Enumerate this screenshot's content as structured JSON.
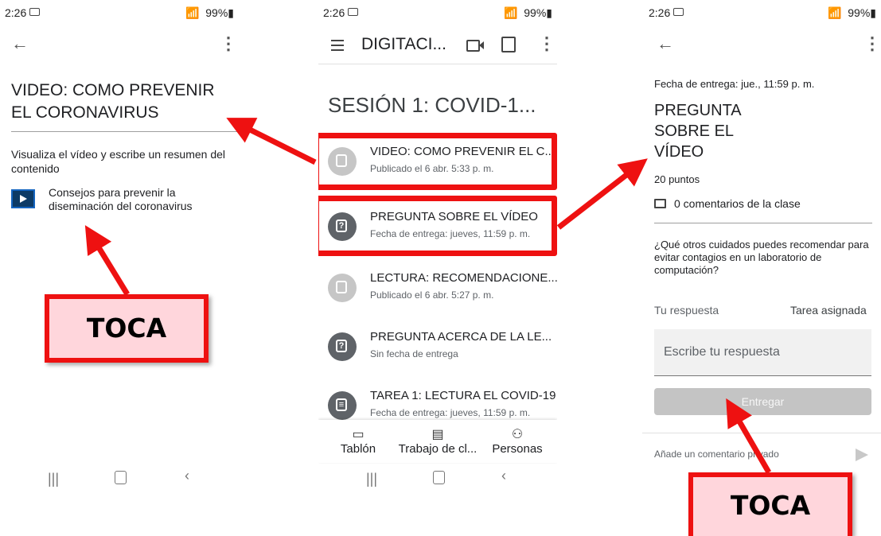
{
  "status": {
    "time": "2:26",
    "icons": "  99%"
  },
  "left": {
    "title_line1": "VIDEO: COMO PREVENIR",
    "title_line2": "EL CORONAVIRUS",
    "desc": "Visualiza el vídeo y escribe un resumen del contenido",
    "attachment_line1": "Consejos para prevenir la",
    "attachment_line2": "diseminación del coronavirus",
    "callout": "TOCA"
  },
  "middle": {
    "class_name": "DIGITACI...",
    "section": "SESIÓN 1: COVID-1...",
    "items": [
      {
        "title": "VIDEO: COMO PREVENIR EL C...",
        "sub": "Publicado el 6 abr. 5:33 p. m.",
        "icon": "book-icon"
      },
      {
        "title": "PREGUNTA SOBRE EL VÍDEO",
        "sub": "Fecha de entrega: jueves, 11:59 p. m.",
        "icon": "question-icon"
      },
      {
        "title": "LECTURA: RECOMENDACIONE...",
        "sub": "Publicado el 6 abr. 5:27 p. m.",
        "icon": "book-icon"
      },
      {
        "title": "PREGUNTA ACERCA DE LA LE...",
        "sub": "Sin fecha de entrega",
        "icon": "question-icon"
      },
      {
        "title": "TAREA 1: LECTURA EL COVID-19",
        "sub": "Fecha de entrega: jueves, 11:59 p. m.",
        "icon": "assignment-icon"
      }
    ],
    "tabs": [
      "Tablón",
      "Trabajo de cl...",
      "Personas"
    ]
  },
  "right": {
    "due": "Fecha de entrega: jue., 11:59 p. m.",
    "title_line1": "PREGUNTA",
    "title_line2": "SOBRE EL",
    "title_line3": "VÍDEO",
    "points": "20 puntos",
    "comments": "0 comentarios de la clase",
    "question": "¿Qué otros cuidados puedes recomendar para evitar contagios en un laboratorio de computación?",
    "your_answer": "Tu respuesta",
    "status": "Tarea asignada",
    "answer_placeholder": "Escribe tu respuesta",
    "submit": "Entregar",
    "private_comment": "Añade un comentario privado",
    "callout": "TOCA"
  },
  "colors": {
    "red": "#ee1111",
    "callout_fill": "#ffd6dc",
    "icon_dark": "#5f6368",
    "icon_light": "#c6c6c6"
  }
}
